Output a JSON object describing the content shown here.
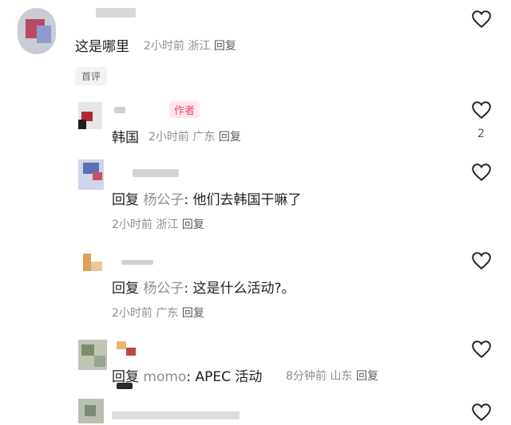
{
  "comments": [
    {
      "text": "这是哪里",
      "time": "2小时前",
      "location": "浙江",
      "reply": "回复"
    },
    {
      "text": "韩国",
      "time": "2小时前",
      "location": "广东",
      "reply": "回复",
      "likes": "2"
    },
    {
      "reply_word": "回复",
      "reply_to": "杨公子",
      "text": ": 他们去韩国干嘛了",
      "time": "2小时前",
      "location": "浙江",
      "reply": "回复"
    },
    {
      "reply_word": "回复",
      "reply_to": "杨公子",
      "text": ": 这是什么活动?。",
      "time": "2小时前",
      "location": "广东",
      "reply": "回复"
    },
    {
      "reply_word": "回复",
      "reply_to": "momo",
      "text": ": APEC 活动",
      "time": "8分钟前",
      "location": "山东",
      "reply": "回复"
    }
  ],
  "first_comment_pill": "首评",
  "author_badge": "作者",
  "colors": {
    "author": "#f0445f",
    "meta": "#8e8e8e"
  },
  "icons": [
    "heart-icon"
  ]
}
